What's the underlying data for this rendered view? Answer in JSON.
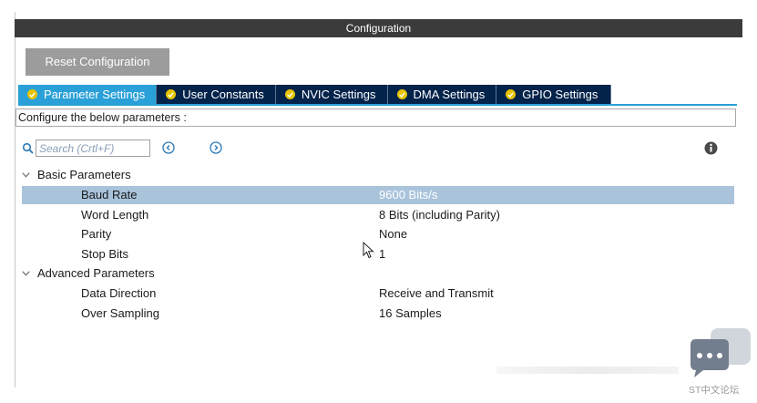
{
  "window": {
    "title": "Configuration"
  },
  "actions": {
    "reset_label": "Reset Configuration"
  },
  "tabs": [
    {
      "label": "Parameter Settings",
      "active": true,
      "icon": "check-circle-icon"
    },
    {
      "label": "User Constants",
      "active": false,
      "icon": "check-circle-icon"
    },
    {
      "label": "NVIC Settings",
      "active": false,
      "icon": "check-circle-icon"
    },
    {
      "label": "DMA Settings",
      "active": false,
      "icon": "check-circle-icon"
    },
    {
      "label": "GPIO Settings",
      "active": false,
      "icon": "check-circle-icon"
    }
  ],
  "description": "Configure the below parameters :",
  "search": {
    "placeholder": "Search (Crtl+F)"
  },
  "groups": {
    "basic": {
      "label": "Basic Parameters",
      "params": [
        {
          "name": "Baud Rate",
          "value": "9600 Bits/s"
        },
        {
          "name": "Word Length",
          "value": "8 Bits (including Parity)"
        },
        {
          "name": "Parity",
          "value": "None"
        },
        {
          "name": "Stop Bits",
          "value": "1"
        }
      ]
    },
    "advanced": {
      "label": "Advanced Parameters",
      "params": [
        {
          "name": "Data Direction",
          "value": "Receive and Transmit"
        },
        {
          "name": "Over Sampling",
          "value": "16 Samples"
        }
      ]
    }
  },
  "watermark": {
    "label": "ST中文论坛"
  },
  "colors": {
    "tab_active": "#2aa0d8",
    "tab_inactive": "#03234b",
    "check_icon": "#e8c400",
    "selection": "#a9c3db",
    "title_bar": "#3b3b3b"
  }
}
